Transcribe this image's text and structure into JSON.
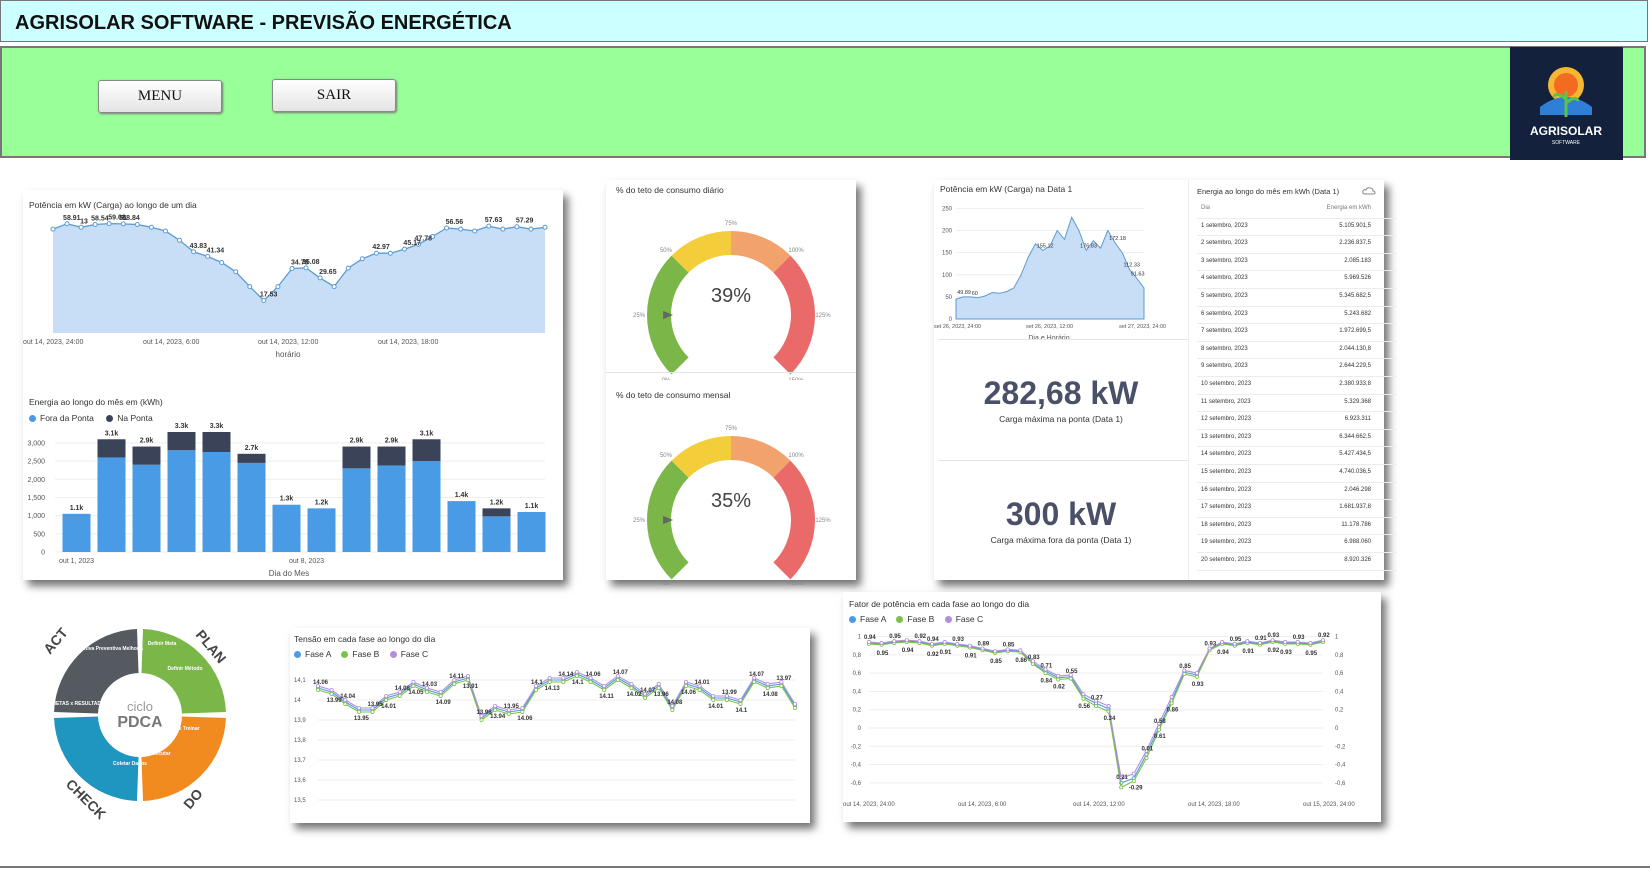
{
  "header": {
    "title": "AGRISOLAR SOFTWARE - PREVISÃO ENERGÉTICA"
  },
  "toolbar": {
    "menu_label": "MENU",
    "exit_label": "SAIR"
  },
  "logo": {
    "text": "AGRISOLAR",
    "subtext": "SOFTWARE"
  },
  "colors": {
    "header_bg": "#ccffff",
    "toolbar_bg": "#99ff99",
    "area_fill": "#c8def6",
    "line": "#5b9bd5",
    "bar_off_peak": "#4a9be5",
    "bar_peak": "#3a4358"
  },
  "power_day": {
    "title": "Potência em kW (Carga) ao longo de um dia",
    "xlabel": "horário",
    "labels": [
      "58.91",
      "13",
      "58.54",
      "59.02",
      "51",
      "58.84",
      "43.83",
      "41.34",
      "17.53",
      "34.78",
      "35.08",
      "29.65",
      "42.97",
      "45.17",
      "47.78",
      "56.56",
      "57.63",
      "57.29"
    ]
  },
  "monthly_energy": {
    "title": "Energia ao longo do mês em (kWh)",
    "legend_off": "Fora da Ponta",
    "legend_peak": "Na Ponta",
    "xlabel": "Dia do Mes"
  },
  "gauge_daily": {
    "title": "% do teto de consumo diário",
    "value_text": "39%"
  },
  "gauge_monthly": {
    "title": "% do teto de consumo mensal",
    "value_text": "35%"
  },
  "gauge_labels": [
    "0%",
    "25%",
    "50%",
    "75%",
    "100%",
    "125%",
    "150%"
  ],
  "power_date1": {
    "title": "Potência em kW (Carga) na Data 1",
    "xlabel": "Dia e Horário",
    "labels": [
      "49.89",
      "60",
      "155.12",
      "176.83",
      "172.18",
      "112.33",
      "91.63"
    ]
  },
  "kpi_peak": {
    "value": "282,68 kW",
    "label": "Carga máxima na ponta (Data 1)"
  },
  "kpi_offpeak": {
    "value": "300 kW",
    "label": "Carga máxima fora da ponta (Data 1)"
  },
  "energy_table": {
    "title": "Energia ao longo do mês em kWh (Data 1)",
    "col_day": "Dia",
    "col_energy": "Energia em kWh",
    "rows": [
      [
        "1 setembro, 2023",
        "5.105.901,5"
      ],
      [
        "2 setembro, 2023",
        "2.236.837,5"
      ],
      [
        "3 setembro, 2023",
        "2.085.183"
      ],
      [
        "4 setembro, 2023",
        "5.969.526"
      ],
      [
        "5 setembro, 2023",
        "5.345.682,5"
      ],
      [
        "6 setembro, 2023",
        "5.243.682"
      ],
      [
        "7 setembro, 2023",
        "1.972.699,5"
      ],
      [
        "8 setembro, 2023",
        "2.044.130,8"
      ],
      [
        "9 setembro, 2023",
        "2.644.229,5"
      ],
      [
        "10 setembro, 2023",
        "2.380.933,8"
      ],
      [
        "11 setembro, 2023",
        "5.329.368"
      ],
      [
        "12 setembro, 2023",
        "6.923.311"
      ],
      [
        "13 setembro, 2023",
        "6.344.662,5"
      ],
      [
        "14 setembro, 2023",
        "5.427.434,5"
      ],
      [
        "15 setembro, 2023",
        "4.740.036,5"
      ],
      [
        "16 setembro, 2023",
        "2.046.298"
      ],
      [
        "17 setembro, 2023",
        "1.681.937,8"
      ],
      [
        "18 setembro, 2023",
        "11.178.786"
      ],
      [
        "19 setembro, 2023",
        "6.988.060"
      ],
      [
        "20 setembro, 2023",
        "8.920.326"
      ]
    ]
  },
  "pdca": {
    "center_small": "ciclo",
    "center_big": "PDCA",
    "plan": "PLAN",
    "do": "DO",
    "check": "CHECK",
    "act": "ACT",
    "s_meta": "Definir Meta",
    "s_metodo": "Definir Método",
    "s_educar": "Educar e Treinar",
    "s_executar": "Executar",
    "s_coletar": "Coletar Dados",
    "s_checar": "Checar: METAS x RESULTADOS",
    "s_acao": "Ação: Corretiva Preventiva Melhoria"
  },
  "voltage": {
    "title": "Tensão em cada fase ao longo do dia",
    "legend": [
      "Fase A",
      "Fase B",
      "Fase C"
    ],
    "labels": [
      "14.06",
      "13.99",
      "14.04",
      "13.95",
      "13.95",
      "14.01",
      "14.08",
      "14.05",
      "14.03",
      "14.09",
      "14.11",
      "13.91",
      "13.96",
      "13.94",
      "13.95",
      "14.06",
      "14.1",
      "14.13",
      "14.14",
      "14.1",
      "14.06",
      "14.11",
      "14.07",
      "14.02",
      "14.07",
      "13.96",
      "14.08",
      "14.06",
      "14.01",
      "14.01",
      "13.99",
      "14.1",
      "14.07",
      "14.08",
      "13.97"
    ]
  },
  "power_factor": {
    "title": "Fator de potência em cada fase ao longo do dia",
    "legend": [
      "Fase A",
      "Fase B",
      "Fase C"
    ],
    "labels": [
      "0.94",
      "0.95",
      "0.95",
      "0.94",
      "0.92",
      "0.92",
      "0.94",
      "0.91",
      "0.93",
      "0.91",
      "0.89",
      "0.85",
      "0.85",
      "0.86",
      "0.83",
      "0.84",
      "0.71",
      "0.62",
      "0.55",
      "0.56",
      "0.27",
      "0.34",
      "0.21",
      "-0.29",
      "0.01",
      "0.61",
      "0.58",
      "0.86",
      "0.85",
      "0.93",
      "0.93",
      "0.94",
      "0.95",
      "0.91",
      "0.91",
      "0.92",
      "0.93",
      "0.93",
      "0.93",
      "0.95",
      "0.92"
    ]
  },
  "chart_data": [
    {
      "type": "area",
      "title": "Potência em kW (Carga) ao longo de um dia",
      "xlabel": "horário",
      "x_ticks": [
        "out 14, 2023, 24:00",
        "out 14, 2023, 6:00",
        "out 14, 2023, 12:00",
        "out 14, 2023, 18:00"
      ],
      "series": [
        {
          "values": [
            56,
            58.9,
            57,
            58.5,
            59,
            58.8,
            58.5,
            57,
            55,
            50,
            43.8,
            41.3,
            38,
            33,
            25,
            17.5,
            25,
            34.8,
            35.1,
            29.7,
            25,
            35,
            40,
            43,
            43,
            45.2,
            47.8,
            52,
            56.6,
            56,
            55,
            57.6,
            56,
            57.3,
            56,
            57
          ]
        }
      ]
    },
    {
      "type": "bar",
      "title": "Energia ao longo do mês em (kWh)",
      "xlabel": "Dia do Mes",
      "x_ticks": [
        "out 1, 2023",
        "out 8, 2023"
      ],
      "y_ticks": [
        "0",
        "500",
        "1,000",
        "1,500",
        "2,000",
        "2,500",
        "3,000"
      ],
      "ylim": [
        0,
        3300
      ],
      "data_labels": [
        "1.1k",
        "3.1k",
        "2.9k",
        "3.3k",
        "3.3k",
        "2.7k",
        "1.3k",
        "1.2k",
        "2.9k",
        "2.9k",
        "3.1k",
        "1.4k",
        "1.2k",
        "1.1k"
      ],
      "series": [
        {
          "name": "Fora da Ponta",
          "values": [
            1050,
            2600,
            2400,
            2800,
            2750,
            2450,
            1300,
            1200,
            2300,
            2380,
            2500,
            1400,
            980,
            1100
          ]
        },
        {
          "name": "Na Ponta",
          "values": [
            0,
            500,
            500,
            500,
            550,
            250,
            0,
            0,
            600,
            520,
            600,
            0,
            220,
            0
          ]
        }
      ]
    },
    {
      "type": "gauge",
      "title": "% do teto de consumo diário",
      "value": 39,
      "marker": 25,
      "range": [
        0,
        150
      ]
    },
    {
      "type": "gauge",
      "title": "% do teto de consumo mensal",
      "value": 35,
      "marker": 25,
      "range": [
        0,
        150
      ]
    },
    {
      "type": "area",
      "title": "Potência em kW (Carga) na Data 1",
      "xlabel": "Dia e Horário",
      "x_ticks": [
        "set 26, 2023, 24:00",
        "set 26, 2023, 12:00",
        "set 27, 2023, 24:00"
      ],
      "y_ticks": [
        "0",
        "50",
        "100",
        "150",
        "200",
        "250"
      ],
      "ylim": [
        0,
        260
      ],
      "series": [
        {
          "values": [
            45,
            49.9,
            50,
            48,
            52,
            60,
            58,
            62,
            70,
            100,
            140,
            170,
            155,
            165,
            200,
            180,
            230,
            200,
            155,
            176.8,
            160,
            200,
            172,
            150,
            112,
            92,
            70
          ]
        }
      ]
    },
    {
      "type": "table",
      "title": "Energia ao longo do mês em kWh (Data 1)",
      "columns": [
        "Dia",
        "Energia em kWh"
      ]
    },
    {
      "type": "line",
      "title": "Tensão em cada fase ao longo do dia",
      "y_ticks": [
        "13,5",
        "13,6",
        "13,7",
        "13,8",
        "13,9",
        "14",
        "14,1"
      ],
      "ylim": [
        13.5,
        14.15
      ],
      "series": [
        {
          "name": "Fase A",
          "values": [
            14.06,
            14.04,
            13.99,
            13.95,
            13.95,
            14.01,
            14.03,
            14.08,
            14.05,
            14.03,
            14.09,
            14.11,
            13.91,
            13.96,
            13.94,
            13.95,
            14.06,
            14.1,
            14.1,
            14.13,
            14.1,
            14.06,
            14.11,
            14.07,
            14.02,
            14.07,
            13.96,
            14.08,
            14.06,
            14.01,
            14.01,
            13.99,
            14.1,
            14.07,
            14.08,
            13.97
          ]
        },
        {
          "name": "Fase B",
          "values": [
            14.05,
            14.03,
            13.98,
            13.94,
            13.94,
            14.0,
            14.02,
            14.07,
            14.04,
            14.02,
            14.08,
            14.1,
            13.9,
            13.95,
            13.93,
            13.94,
            14.05,
            14.09,
            14.09,
            14.12,
            14.09,
            14.05,
            14.1,
            14.06,
            14.01,
            14.06,
            13.95,
            14.07,
            14.05,
            14.0,
            14.0,
            13.98,
            14.09,
            14.06,
            14.07,
            13.96
          ]
        },
        {
          "name": "Fase C",
          "values": [
            14.07,
            14.05,
            14.0,
            13.96,
            13.96,
            14.02,
            14.04,
            14.09,
            14.06,
            14.04,
            14.1,
            14.12,
            13.92,
            13.97,
            13.95,
            13.96,
            14.07,
            14.11,
            14.11,
            14.14,
            14.11,
            14.07,
            14.12,
            14.08,
            14.03,
            14.08,
            13.97,
            14.09,
            14.07,
            14.02,
            14.02,
            14.0,
            14.11,
            14.08,
            14.09,
            13.98
          ]
        }
      ]
    },
    {
      "type": "line",
      "title": "Fator de potência em cada fase ao longo do dia",
      "x_ticks": [
        "out 14, 2023, 24:00",
        "out 14, 2023, 6:00",
        "out 14, 2023, 12:00",
        "out 14, 2023, 18:00",
        "out 15, 2023, 24:00"
      ],
      "y_ticks": [
        "-0,6",
        "-0,4",
        "-0,2",
        "0",
        "0,2",
        "0,4",
        "0,6",
        "0,8",
        "1"
      ],
      "ylim": [
        -0.7,
        1.05
      ],
      "series": [
        {
          "name": "Fase A",
          "values": [
            0.93,
            0.92,
            0.94,
            0.95,
            0.94,
            0.91,
            0.93,
            0.91,
            0.89,
            0.86,
            0.83,
            0.85,
            0.84,
            0.71,
            0.62,
            0.55,
            0.56,
            0.34,
            0.27,
            0.21,
            -0.6,
            -0.55,
            -0.29,
            0.01,
            0.3,
            0.61,
            0.58,
            0.86,
            0.93,
            0.91,
            0.94,
            0.92,
            0.95,
            0.93,
            0.93,
            0.92,
            0.95
          ]
        },
        {
          "name": "Fase B",
          "values": [
            0.92,
            0.91,
            0.93,
            0.94,
            0.93,
            0.9,
            0.92,
            0.9,
            0.88,
            0.85,
            0.82,
            0.84,
            0.83,
            0.7,
            0.6,
            0.53,
            0.54,
            0.32,
            0.24,
            0.18,
            -0.65,
            -0.58,
            -0.33,
            -0.02,
            0.27,
            0.59,
            0.56,
            0.85,
            0.92,
            0.9,
            0.93,
            0.91,
            0.94,
            0.92,
            0.92,
            0.91,
            0.94
          ]
        },
        {
          "name": "Fase C",
          "values": [
            0.94,
            0.93,
            0.95,
            0.96,
            0.95,
            0.92,
            0.94,
            0.92,
            0.9,
            0.87,
            0.84,
            0.86,
            0.85,
            0.73,
            0.64,
            0.57,
            0.58,
            0.37,
            0.3,
            0.24,
            -0.55,
            -0.5,
            -0.25,
            0.05,
            0.34,
            0.63,
            0.6,
            0.87,
            0.94,
            0.92,
            0.95,
            0.93,
            0.96,
            0.94,
            0.94,
            0.93,
            0.96
          ]
        }
      ]
    }
  ]
}
